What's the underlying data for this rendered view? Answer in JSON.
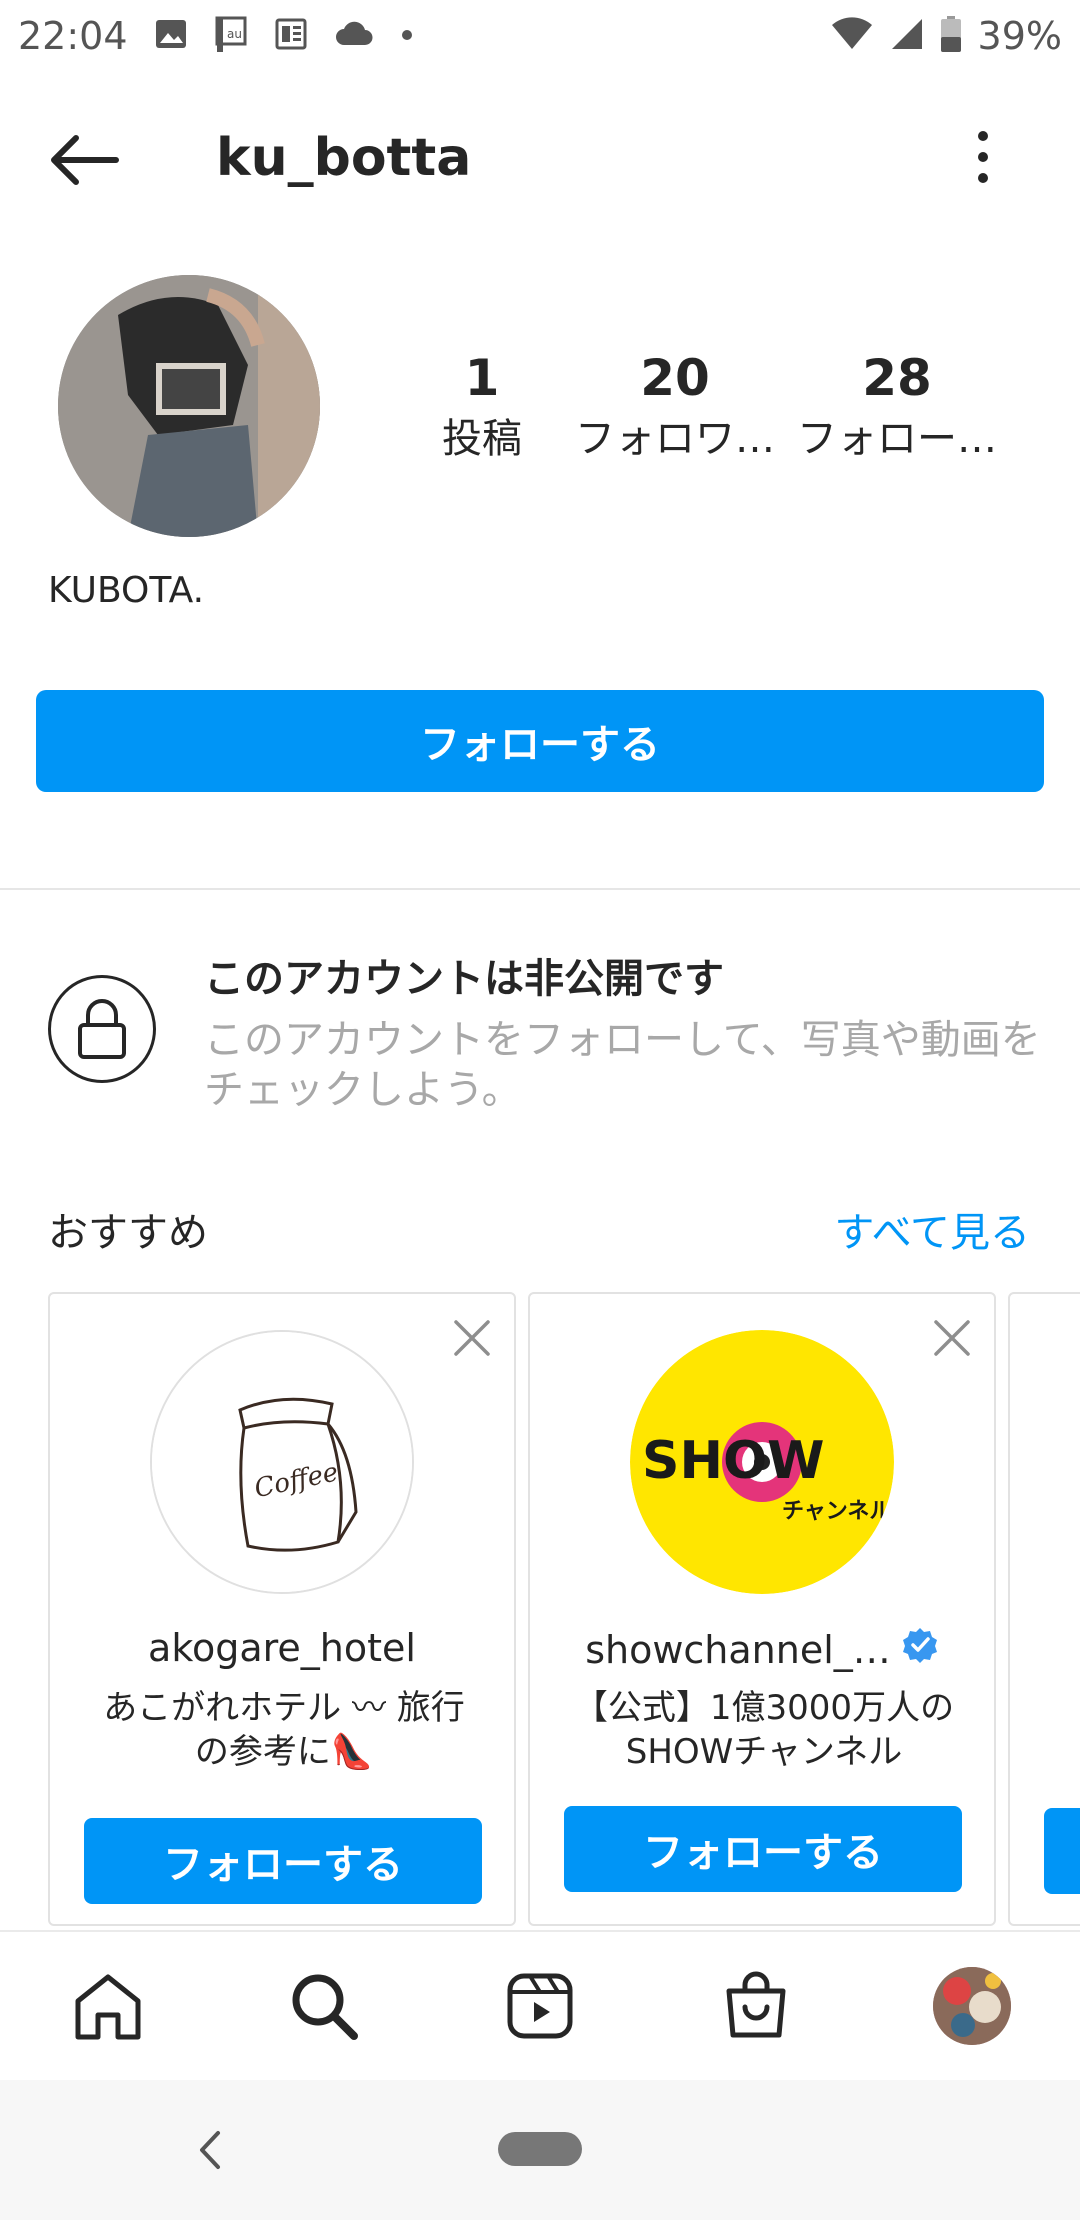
{
  "status_bar": {
    "time": "22:04",
    "battery": "39%",
    "icons": [
      "image-icon",
      "au-icon",
      "news-icon",
      "cloud-icon",
      "dot-icon",
      "wifi-icon",
      "signal-icon",
      "battery-icon"
    ]
  },
  "header": {
    "username": "ku_botta"
  },
  "profile": {
    "stats": [
      {
        "value": "1",
        "label": "投稿"
      },
      {
        "value": "20",
        "label": "フォロワ…"
      },
      {
        "value": "28",
        "label": "フォロー…"
      }
    ],
    "display_name": "KUBOTA.",
    "follow_label": "フォローする"
  },
  "private": {
    "title": "このアカウントは非公開です",
    "description": "このアカウントをフォローして、写真や動画をチェックしよう。"
  },
  "suggestions": {
    "title": "おすすめ",
    "see_all": "すべて見る",
    "cards": [
      {
        "name": "akogare_hotel",
        "bio_line1": "あこがれホテル 〰 旅行",
        "bio_line2": "の参考に👠",
        "follow_label": "フォローする",
        "verified": false
      },
      {
        "name": "showchannel_…",
        "bio_line1": "【公式】1億3000万人の",
        "bio_line2": "SHOWチャンネル",
        "follow_label": "フォローする",
        "verified": true,
        "logo_text": "SHOW",
        "logo_sub": "チャンネル"
      }
    ]
  },
  "colors": {
    "accent": "#0095f6",
    "text": "#262626",
    "secondary_text": "#a8a8a8"
  },
  "bottom_nav": [
    "home-icon",
    "search-icon",
    "reels-icon",
    "shop-icon",
    "profile-avatar"
  ]
}
